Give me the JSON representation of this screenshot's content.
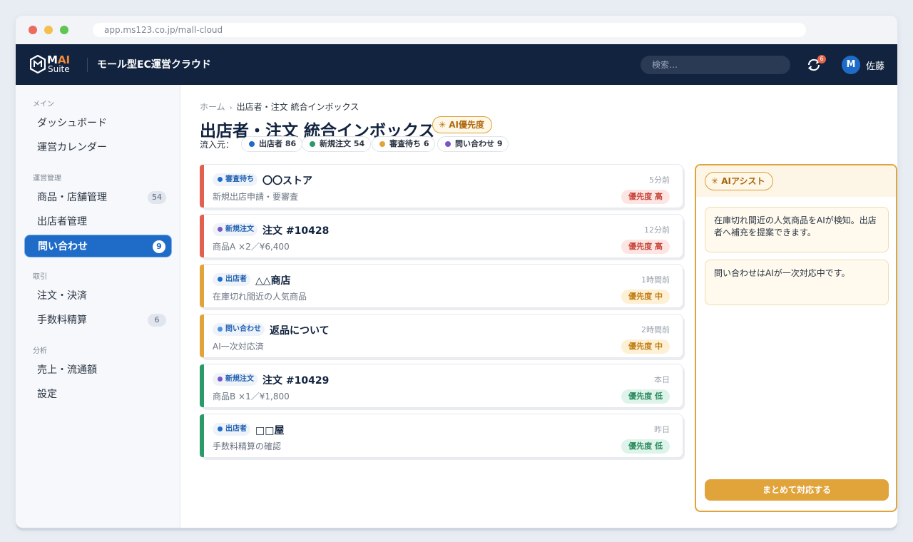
{
  "browser": {
    "url": "app.ms123.co.jp/mall-cloud"
  },
  "header": {
    "logo_top": "MAI",
    "logo_accent": "AI",
    "logo_bottom": "Suite",
    "app_title": "モール型EC運営クラウド",
    "search_placeholder": "検索…",
    "notification_count": "6",
    "avatar_initial": "M",
    "user_name": "佐藤"
  },
  "sidebar": {
    "sections": [
      {
        "label": "メイン",
        "items": [
          {
            "label": "ダッシュボード"
          },
          {
            "label": "運営カレンダー"
          }
        ]
      },
      {
        "label": "運営管理",
        "items": [
          {
            "label": "商品・店舗管理",
            "badge": "54"
          },
          {
            "label": "出店者管理"
          },
          {
            "label": "問い合わせ",
            "badge": "9",
            "active": true
          }
        ]
      },
      {
        "label": "取引",
        "items": [
          {
            "label": "注文・決済"
          },
          {
            "label": "手数料精算",
            "badge": "6"
          }
        ]
      },
      {
        "label": "分析",
        "items": [
          {
            "label": "売上・流通額"
          },
          {
            "label": "設定"
          }
        ]
      }
    ]
  },
  "breadcrumb": {
    "home": "ホーム",
    "current": "出店者・注文 統合インボックス"
  },
  "page": {
    "title": "出店者・注文 統合インボックス",
    "ai_tag": "AI優先度",
    "source_label": "流入元：",
    "sources": [
      {
        "label": "出店者 86",
        "color": "#1e6cc8"
      },
      {
        "label": "新規注文 54",
        "color": "#2a9a6a"
      },
      {
        "label": "審査待ち 6",
        "color": "#e1a43b"
      },
      {
        "label": "問い合わせ 9",
        "color": "#7a55c8"
      }
    ]
  },
  "inbox": [
    {
      "tag": "審査待ち",
      "tag_dot": "#1e6cc8",
      "title": "〇〇ストア",
      "sub": "新規出店申請・要審査",
      "time": "5分前",
      "priority": "優先度 高",
      "level": "high",
      "bar": "#e2604f"
    },
    {
      "tag": "新規注文",
      "tag_dot": "#7a55c8",
      "title": "注文 #10428",
      "sub": "商品A ×2／¥6,400",
      "time": "12分前",
      "priority": "優先度 高",
      "level": "high",
      "bar": "#e2604f"
    },
    {
      "tag": "出店者",
      "tag_dot": "#1e6cc8",
      "title": "△△商店",
      "sub": "在庫切れ間近の人気商品",
      "time": "1時間前",
      "priority": "優先度 中",
      "level": "mid",
      "bar": "#e1a43b"
    },
    {
      "tag": "問い合わせ",
      "tag_dot": "#4a90e2",
      "title": "返品について",
      "sub": "AI一次対応済",
      "time": "2時間前",
      "priority": "優先度 中",
      "level": "mid",
      "bar": "#e1a43b"
    },
    {
      "tag": "新規注文",
      "tag_dot": "#7a55c8",
      "title": "注文 #10429",
      "sub": "商品B ×1／¥1,800",
      "time": "本日",
      "priority": "優先度 低",
      "level": "low",
      "bar": "#2a9a6a"
    },
    {
      "tag": "出店者",
      "tag_dot": "#1e6cc8",
      "title": "□□屋",
      "sub": "手数料精算の確認",
      "time": "昨日",
      "priority": "優先度 低",
      "level": "low",
      "bar": "#2a9a6a"
    }
  ],
  "assist": {
    "title": "AIアシスト",
    "messages": [
      "在庫切れ間近の人気商品をAIが検知。出店者へ補充を提案できます。",
      "問い合わせはAIが一次対応中です。"
    ],
    "button": "まとめて対応する"
  }
}
